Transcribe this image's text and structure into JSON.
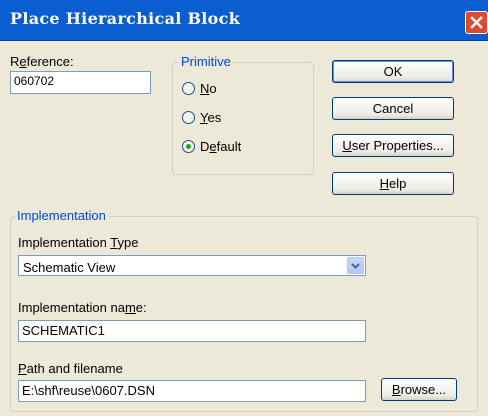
{
  "window": {
    "title": "Place Hierarchical Block",
    "close_icon": "close-icon"
  },
  "reference": {
    "label_first": "R",
    "label_underlined": "e",
    "label_rest": "ference:",
    "value": "060702"
  },
  "primitive": {
    "caption": "Primitive",
    "options": [
      {
        "underlined": "N",
        "rest": "o",
        "checked": false
      },
      {
        "underlined": "Y",
        "rest": "es",
        "checked": false
      },
      {
        "pre": "D",
        "underlined": "e",
        "rest": "fault",
        "checked": true
      }
    ]
  },
  "buttons": {
    "ok": "OK",
    "cancel": "Cancel",
    "user_properties_underlined": "U",
    "user_properties_rest": "ser Properties...",
    "help_underlined": "H",
    "help_rest": "elp",
    "browse_underlined": "B",
    "browse_rest": "rowse..."
  },
  "implementation": {
    "caption": "Implementation",
    "type_label_pre": "Implementation ",
    "type_label_underlined": "T",
    "type_label_rest": "ype",
    "type_value": "Schematic View",
    "name_label_pre": "Implementation na",
    "name_label_underlined": "m",
    "name_label_rest": "e:",
    "name_value": "SCHEMATIC1",
    "path_label_underlined": "P",
    "path_label_rest": "ath and filename",
    "path_value": "E:\\shf\\reuse\\0607.DSN"
  }
}
